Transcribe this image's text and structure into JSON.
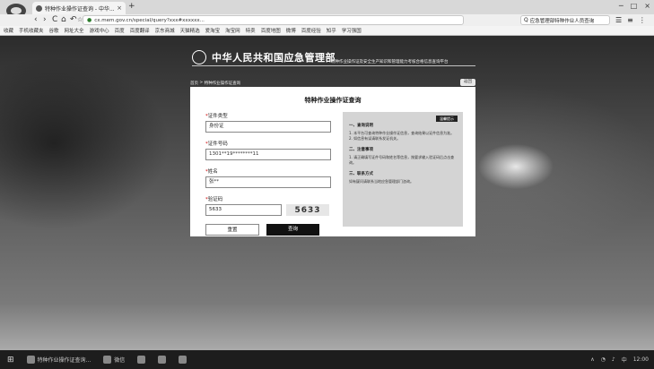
{
  "browser": {
    "tab_title": "特种作业操作证查询 - 中华...",
    "tab_close": "×",
    "new_tab": "+",
    "window_controls": [
      "─",
      "□",
      "×"
    ],
    "nav": {
      "back": "‹",
      "forward": "›",
      "refresh": "C",
      "home": "⌂",
      "undo": "↶",
      "star": "☆"
    },
    "url": "cx.mem.gov.cn/special/query?xxx#xxxxxx...",
    "search_text": "应急管理部特种作业人员查询",
    "tool_icons": [
      "☰",
      "≡",
      "⋮"
    ],
    "bookmarks": [
      "收藏",
      "手机收藏夹",
      "谷歌",
      "网址大全",
      "游戏中心",
      "百度",
      "百度翻译",
      "京东商城",
      "天猫精选",
      "爱淘宝",
      "淘宝网",
      "特卖",
      "百度地图",
      "微博",
      "百度经验",
      "知乎",
      "学习强国"
    ]
  },
  "site": {
    "title": "中华人民共和国应急管理部",
    "subtitle": "特种作业操作证及安全生产知识和管理能力考核合格信息查询平台",
    "breadcrumb": [
      "首页",
      "特种作业操作证查询"
    ],
    "back_label": "返回"
  },
  "form": {
    "title": "特种作业操作证查询",
    "fields": [
      {
        "label": "证件类型",
        "value": "身份证",
        "required": true
      },
      {
        "label": "证件号码",
        "value": "1301**19********11",
        "required": true
      },
      {
        "label": "姓名",
        "value": "张**",
        "required": true
      },
      {
        "label": "验证码",
        "value": "5633",
        "required": true
      }
    ],
    "captcha_code": "5633",
    "reset_label": "重置",
    "query_label": "查询"
  },
  "notes": {
    "badge": "温馨提示",
    "items": [
      {
        "title": "一、查询说明",
        "text": "1. 本平台可查询特种作业操作证信息，查询结果以证件信息为准。2. 如信息有误请联系发证机关。"
      },
      {
        "title": "二、注意事项",
        "text": "1. 请正确填写证件号码和姓名等信息，按要求输入验证码后点击查询。"
      },
      {
        "title": "三、联系方式",
        "text": "如有疑问请联系当地应急管理部门咨询。"
      }
    ]
  },
  "taskbar": {
    "start": "⊞",
    "items": [
      "特种作业操作证查询...",
      "微信",
      "",
      "",
      ""
    ],
    "time": "12:00",
    "tray": [
      "∧",
      "◔",
      "♪",
      "中"
    ]
  }
}
